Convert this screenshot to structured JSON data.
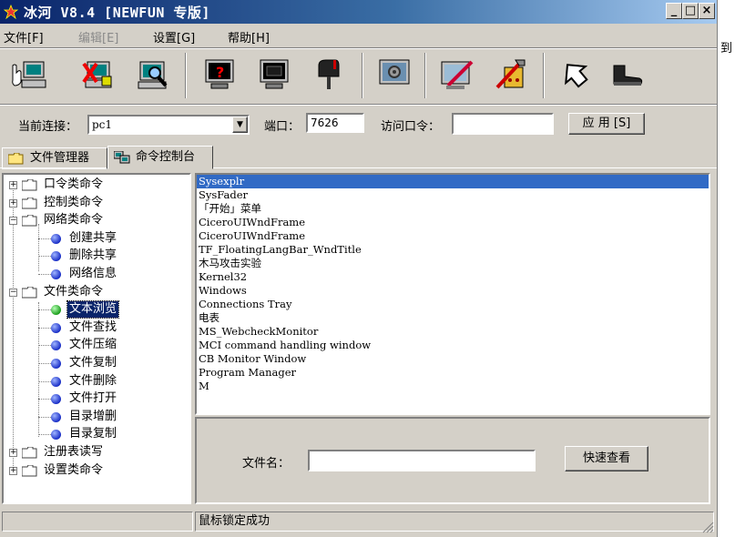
{
  "window": {
    "title": "冰河 V8.4 [NEWFUN 专版]",
    "controls": {
      "minimize": "_",
      "maximize": "□",
      "close": "×"
    }
  },
  "menu": {
    "items": [
      {
        "label": "文件[F]",
        "enabled": true
      },
      {
        "label": "编辑[E]",
        "enabled": false
      },
      {
        "label": "设置[G]",
        "enabled": true
      },
      {
        "label": "帮助[H]",
        "enabled": true
      }
    ]
  },
  "toolbar": {
    "buttons": [
      {
        "icon": "hand-computer-icon"
      },
      {
        "icon": "delete-computer-icon"
      },
      {
        "icon": "search-computer-icon"
      },
      {
        "icon": "screen-help-icon"
      },
      {
        "icon": "screen-capture-icon"
      },
      {
        "icon": "mailbox-icon"
      },
      {
        "icon": "screen-control-icon"
      },
      {
        "icon": "settings-monitor-icon"
      },
      {
        "icon": "config-tools-icon"
      },
      {
        "icon": "upgrade-arrow-icon"
      },
      {
        "icon": "exit-boot-icon"
      }
    ]
  },
  "connection": {
    "current_label": "当前连接：",
    "current_value": "pc1",
    "port_label": "端口：",
    "port_value": "7626",
    "password_label": "访问口令：",
    "password_value": "",
    "apply_label": "应 用 [S]"
  },
  "tabs": [
    {
      "label": "文件管理器",
      "icon": "folder-icon",
      "active": false
    },
    {
      "label": "命令控制台",
      "icon": "computers-icon",
      "active": true
    }
  ],
  "tree": {
    "nodes": [
      {
        "label": "口令类命令",
        "type": "folder",
        "expander": "+"
      },
      {
        "label": "控制类命令",
        "type": "folder",
        "expander": "+"
      },
      {
        "label": "网络类命令",
        "type": "folder",
        "expander": "−"
      },
      {
        "label": "创建共享",
        "type": "leaf"
      },
      {
        "label": "删除共享",
        "type": "leaf"
      },
      {
        "label": "网络信息",
        "type": "leaf"
      },
      {
        "label": "文件类命令",
        "type": "folder",
        "expander": "−"
      },
      {
        "label": "文本浏览",
        "type": "leaf",
        "selected": true
      },
      {
        "label": "文件查找",
        "type": "leaf"
      },
      {
        "label": "文件压缩",
        "type": "leaf"
      },
      {
        "label": "文件复制",
        "type": "leaf"
      },
      {
        "label": "文件删除",
        "type": "leaf"
      },
      {
        "label": "文件打开",
        "type": "leaf"
      },
      {
        "label": "目录增删",
        "type": "leaf"
      },
      {
        "label": "目录复制",
        "type": "leaf"
      },
      {
        "label": "注册表读写",
        "type": "folder",
        "expander": "+"
      },
      {
        "label": "设置类命令",
        "type": "folder",
        "expander": "+"
      }
    ]
  },
  "window_list": {
    "items": [
      "Sysexplr",
      "SysFader",
      "「开始」菜单",
      "CiceroUIWndFrame",
      "CiceroUIWndFrame",
      "TF_FloatingLangBar_WndTitle",
      "木马攻击实验",
      "Kernel32",
      "Windows",
      "Connections Tray",
      "电表",
      "MS_WebcheckMonitor",
      "MCI command handling window",
      "CB Monitor Window",
      "Program Manager",
      "M"
    ],
    "selected_index": 0
  },
  "lower": {
    "filename_label": "文件名：",
    "filename_value": "",
    "view_button": "快速查看"
  },
  "status": {
    "left": "",
    "message": "鼠标锁定成功"
  },
  "background_window": {
    "text": "到"
  },
  "colors": {
    "title_start": "#0a246a",
    "selection": "#316ac5",
    "face": "#d4d0c8"
  }
}
